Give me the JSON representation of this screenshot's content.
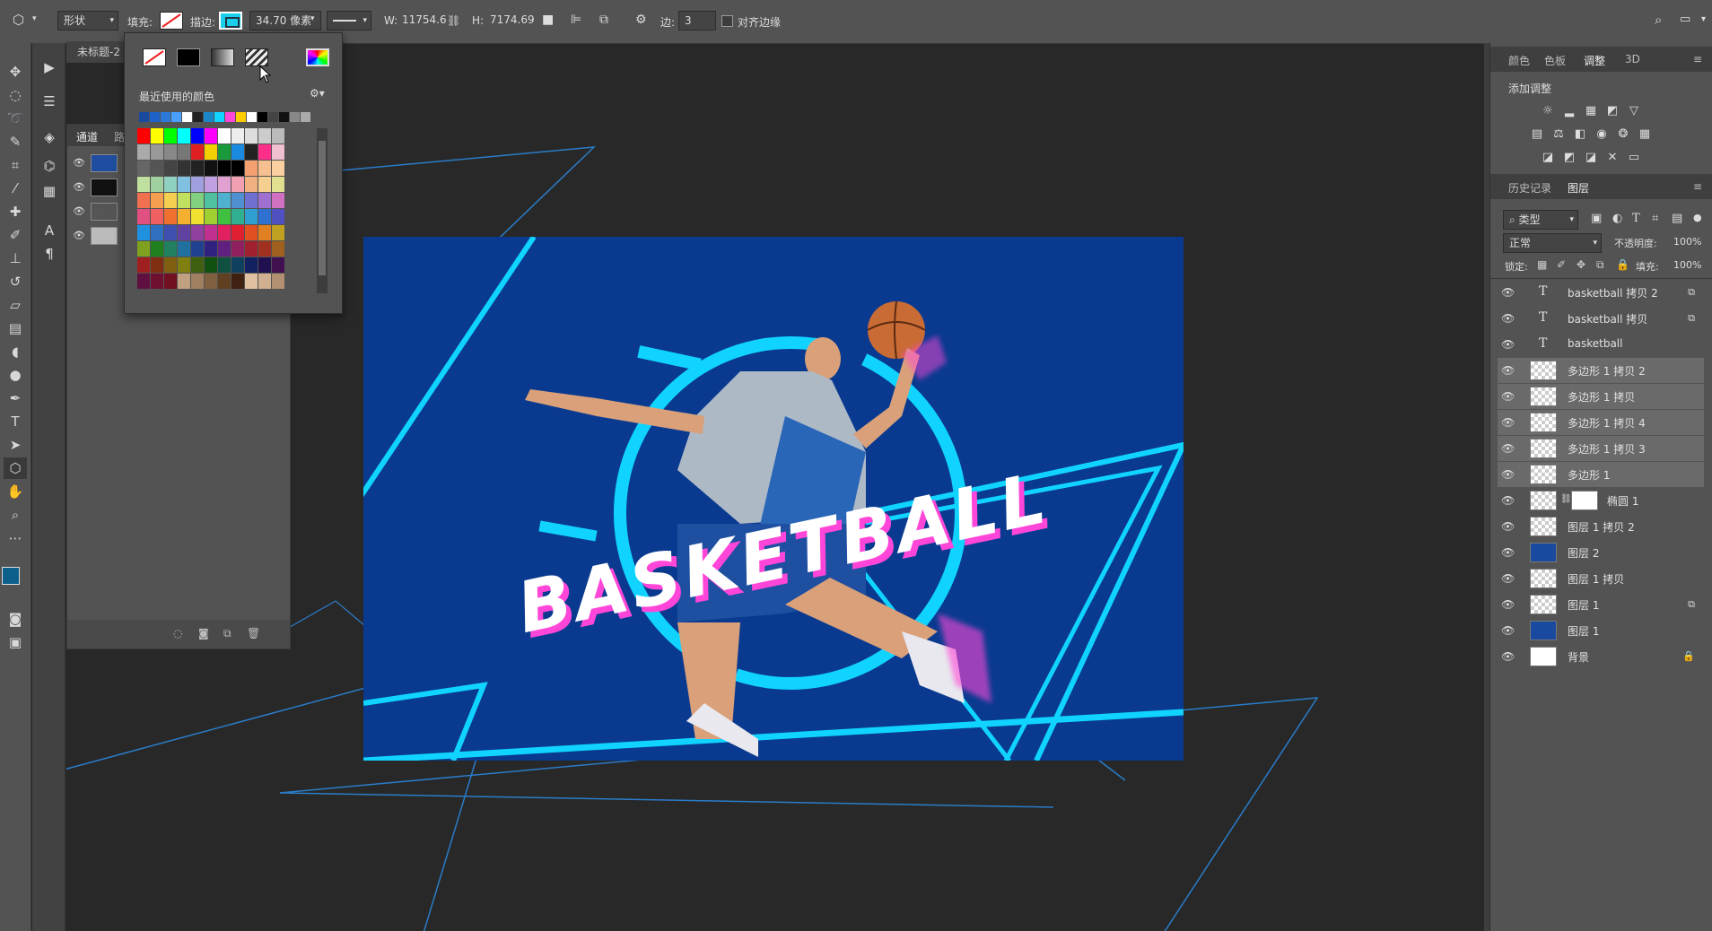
{
  "options": {
    "mode": "形状",
    "fill_label": "填充:",
    "stroke_label": "描边:",
    "stroke_width": "34.70 像素",
    "w_label": "W:",
    "w_value": "11754.6",
    "h_label": "H:",
    "h_value": "7174.69",
    "sides_label": "边:",
    "sides_value": "3",
    "align_edges": "对齐边缘",
    "stroke_color": "#00c8e6"
  },
  "document": {
    "tab_title": "未标题-2"
  },
  "channels": {
    "tab1": "通道",
    "tab2": "路"
  },
  "swatch_popup": {
    "recent_label": "最近使用的颜色"
  },
  "canvas": {
    "artboard_bg": "#0a3a8f",
    "neon": "#10d4ff",
    "title_text": "BASKETBALL",
    "title_color": "#ffffff",
    "glow_color": "#ff46d8"
  },
  "right_panel": {
    "tabs_top": [
      "颜色",
      "色板",
      "调整",
      "3D"
    ],
    "add_adjustment": "添加调整",
    "tabs_mid": [
      "历史记录",
      "图层"
    ],
    "filter_kind": "类型",
    "blend_mode": "正常",
    "opacity_label": "不透明度:",
    "opacity_value": "100%",
    "lock_label": "锁定:",
    "fill_label": "填充:",
    "fill_value": "100%"
  },
  "layers": [
    {
      "name": "basketball 拷贝 2",
      "kind": "text"
    },
    {
      "name": "basketball 拷贝",
      "kind": "text"
    },
    {
      "name": "basketball",
      "kind": "text"
    },
    {
      "name": "多边形 1 拷贝 2",
      "kind": "shape"
    },
    {
      "name": "多边形 1 拷贝",
      "kind": "shape"
    },
    {
      "name": "多边形 1 拷贝 4",
      "kind": "shape"
    },
    {
      "name": "多边形 1 拷贝 3",
      "kind": "shape"
    },
    {
      "name": "多边形 1",
      "kind": "shape"
    },
    {
      "name": "椭圆 1",
      "kind": "ellipse"
    },
    {
      "name": "图层 1 拷贝 2",
      "kind": "image"
    },
    {
      "name": "图层 2",
      "kind": "image-blue"
    },
    {
      "name": "图层 1 拷贝",
      "kind": "image"
    },
    {
      "name": "图层 1",
      "kind": "image"
    },
    {
      "name": "图层 1",
      "kind": "solid-blue"
    },
    {
      "name": "背景",
      "kind": "white"
    }
  ]
}
